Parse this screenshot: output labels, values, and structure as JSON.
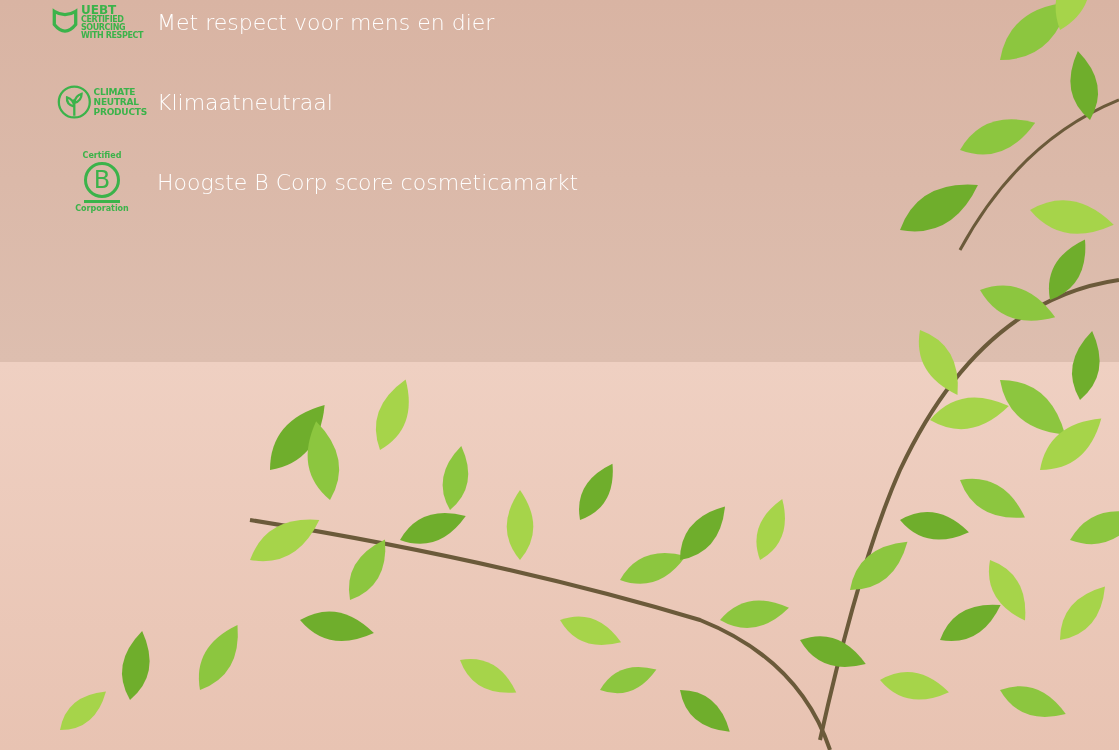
{
  "features": [
    {
      "kind": "uebt",
      "logo_lines": [
        "UEBT",
        "CERTIFIED",
        "SOURCING",
        "WITH RESPECT"
      ],
      "label": "Met respect voor mens en dier"
    },
    {
      "kind": "climate",
      "logo_lines": [
        "CLIMATE",
        "NEUTRAL",
        "PRODUCTS"
      ],
      "label": "Klimaatneutraal"
    },
    {
      "kind": "bcorp",
      "logo_lines": [
        "Certified",
        "B",
        "Corporation"
      ],
      "label": "Hoogste B Corp score cosmeticamarkt"
    }
  ]
}
